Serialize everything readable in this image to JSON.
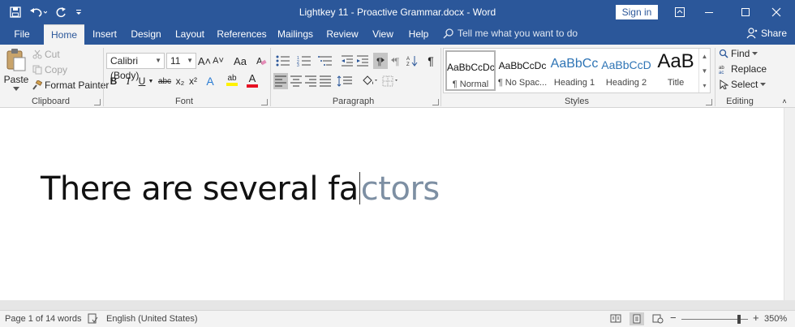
{
  "title_bar": {
    "document_title": "Lightkey 11 - Proactive Grammar.docx  -  Word",
    "sign_in_label": "Sign in",
    "qat_icons": [
      "save-icon",
      "undo-icon",
      "redo-icon",
      "customize-qat-icon"
    ],
    "window_controls": [
      "ribbon-display-options-icon",
      "minimize-icon",
      "maximize-icon",
      "close-icon"
    ]
  },
  "tabs": [
    {
      "label": "File"
    },
    {
      "label": "Home",
      "active": true
    },
    {
      "label": "Insert"
    },
    {
      "label": "Design"
    },
    {
      "label": "Layout"
    },
    {
      "label": "References"
    },
    {
      "label": "Mailings"
    },
    {
      "label": "Review"
    },
    {
      "label": "View"
    },
    {
      "label": "Help"
    }
  ],
  "tell_me": {
    "placeholder": "Tell me what you want to do"
  },
  "share_label": "Share",
  "clipboard": {
    "paste": "Paste",
    "cut": "Cut",
    "copy": "Copy",
    "format_painter": "Format Painter",
    "group_label": "Clipboard"
  },
  "font": {
    "font_name": "Calibri (Body)",
    "font_size": "11",
    "group_label": "Font",
    "change_case": "Aa",
    "bold": "B",
    "italic": "I",
    "underline": "U",
    "strikethrough": "abc",
    "subscript": "x₂",
    "superscript": "x²",
    "text_effects": "A",
    "highlight": "ab",
    "font_color": "A",
    "grow": "A˄",
    "shrink": "A˅",
    "highlight_color": "#fff200",
    "font_color_value": "#e81123"
  },
  "paragraph": {
    "group_label": "Paragraph"
  },
  "styles": {
    "group_label": "Styles",
    "items": [
      {
        "sample": "AaBbCcDc",
        "name": "¶ Normal"
      },
      {
        "sample": "AaBbCcDc",
        "name": "¶ No Spac..."
      },
      {
        "sample": "AaBbCc",
        "name": "Heading 1"
      },
      {
        "sample": "AaBbCcD",
        "name": "Heading 2"
      },
      {
        "sample": "AaB",
        "name": "Title"
      }
    ]
  },
  "editing": {
    "find": "Find",
    "replace": "Replace",
    "select": "Select",
    "group_label": "Editing"
  },
  "document": {
    "typed_text": "There are several fa",
    "suggested_completion": "ctors"
  },
  "status_bar": {
    "page": "Page 1 of 1",
    "words": "4 words",
    "language": "English (United States)",
    "zoom": "350%",
    "zoom_fraction": 0.86
  },
  "colors": {
    "accent": "#2b579a",
    "ribbon_bg": "#f3f3f3",
    "suggestion_text": "#7d8fa3"
  }
}
